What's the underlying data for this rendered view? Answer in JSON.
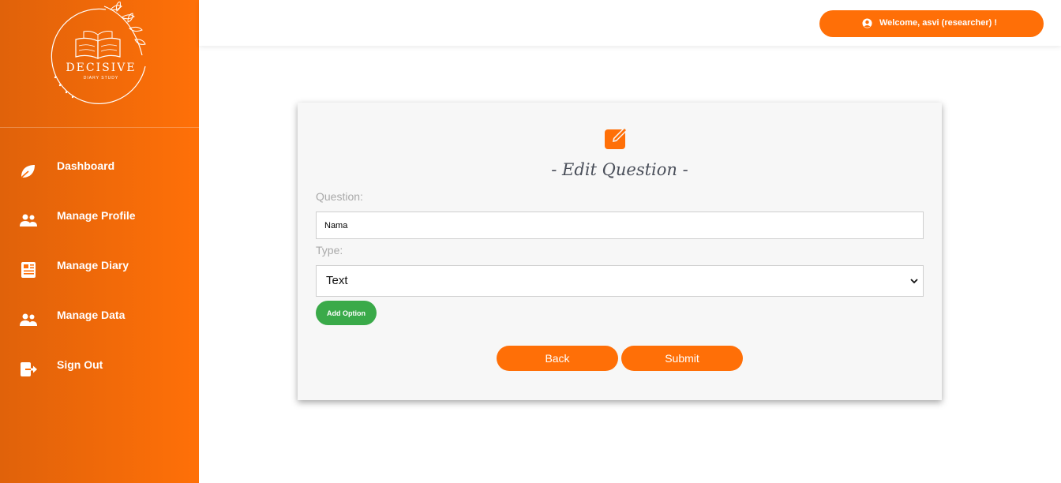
{
  "brand": {
    "name": "DECISIVE",
    "tagline": "DIARY STUDY",
    "accent": "#ff6f07",
    "green": "#3aaa49"
  },
  "sidebar": {
    "items": [
      {
        "label": "Dashboard",
        "icon": "leaf-icon"
      },
      {
        "label": "Manage Profile",
        "icon": "users-icon"
      },
      {
        "label": "Manage Diary",
        "icon": "newspaper-icon"
      },
      {
        "label": "Manage Data",
        "icon": "users-icon"
      },
      {
        "label": "Sign Out",
        "icon": "sign-out-icon"
      }
    ]
  },
  "header": {
    "welcome": "Welcome, asvi (researcher) !",
    "icon": "user-circle-icon"
  },
  "form": {
    "icon": "edit-icon",
    "title": "- Edit Question -",
    "question_label": "Question:",
    "question_value": "Nama",
    "type_label": "Type:",
    "type_value": "Text",
    "add_option_label": "Add Option",
    "back_label": "Back",
    "submit_label": "Submit"
  }
}
